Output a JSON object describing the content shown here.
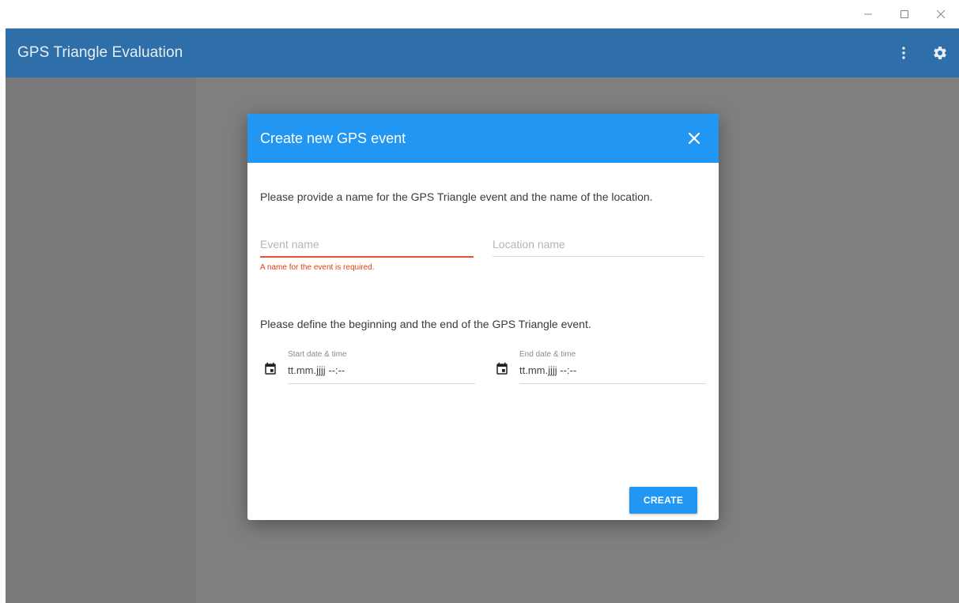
{
  "window": {
    "minimize_icon": "minimize-icon",
    "maximize_icon": "maximize-icon",
    "close_icon": "close-icon"
  },
  "appbar": {
    "title": "GPS Triangle Evaluation",
    "menu_icon": "more-vert-icon",
    "settings_icon": "gear-icon",
    "color": "#2f6fa9"
  },
  "dialog": {
    "title": "Create new GPS event",
    "close_icon": "close-icon",
    "intro": "Please provide a name for the GPS Triangle event and the name of the location.",
    "event_name": {
      "value": "",
      "placeholder": "Event name",
      "error": "A name for the event is required."
    },
    "location_name": {
      "value": "",
      "placeholder": "Location name"
    },
    "dates_intro": "Please define the beginning and the end of the GPS Triangle event.",
    "start": {
      "label": "Start date & time",
      "value": "tt.mm.jjjj --:--",
      "icon": "calendar-icon"
    },
    "end": {
      "label": "End date & time",
      "value": "tt.mm.jjjj --:--",
      "icon": "calendar-icon"
    },
    "create_label": "CREATE",
    "accent": "#2196f3",
    "error_color": "#e0401a"
  }
}
